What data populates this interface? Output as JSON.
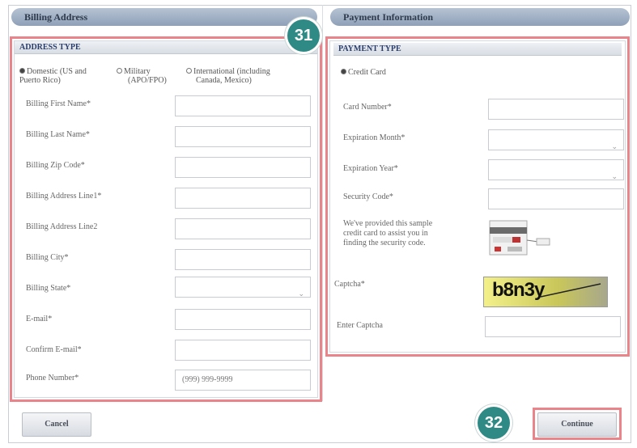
{
  "billing": {
    "header": "Billing Address",
    "address_type_label": "ADDRESS TYPE",
    "address_types": [
      {
        "label_line1": "Domestic (US and",
        "label_line2": "Puerto Rico)",
        "selected": true
      },
      {
        "label_line1": "Military",
        "label_line2": "(APO/FPO)",
        "selected": false
      },
      {
        "label_line1": "International (including",
        "label_line2": "Canada, Mexico)",
        "selected": false
      }
    ],
    "fields": [
      {
        "label": "Billing First Name*",
        "value": ""
      },
      {
        "label": "Billing Last Name*",
        "value": ""
      },
      {
        "label": "Billing Zip Code*",
        "value": ""
      },
      {
        "label": "Billing Address Line1*",
        "value": ""
      },
      {
        "label": "Billing Address Line2",
        "value": ""
      },
      {
        "label": "Billing City*",
        "value": ""
      },
      {
        "label": "Billing State*",
        "value": "",
        "type": "select"
      },
      {
        "label": "E-mail*",
        "value": ""
      },
      {
        "label": "Confirm E-mail*",
        "value": ""
      },
      {
        "label": "Phone Number*",
        "value": "",
        "placeholder": "(999) 999-9999"
      }
    ]
  },
  "payment": {
    "header": "Payment Information",
    "payment_type_label": "PAYMENT TYPE",
    "payment_types": [
      {
        "label": "Credit Card",
        "selected": true
      }
    ],
    "fields": [
      {
        "label": "Card Number*",
        "value": ""
      },
      {
        "label": "Expiration Month*",
        "value": "",
        "type": "select"
      },
      {
        "label": "Expiration Year*",
        "value": "",
        "type": "select"
      },
      {
        "label": "Security Code*",
        "value": ""
      }
    ],
    "security_note_lines": [
      "We've provided this sample",
      "credit card to assist you in",
      "finding the security code."
    ],
    "captcha_label": "Captcha*",
    "captcha_text": "b8n3y",
    "enter_captcha_label": "Enter Captcha",
    "enter_captcha_value": ""
  },
  "callouts": {
    "badge_31": "31",
    "badge_32": "32"
  },
  "buttons": {
    "cancel": "Cancel",
    "continue": "Continue"
  },
  "colors": {
    "header_bg": "#9fb0c6",
    "callout": "#2f8a86",
    "highlight": "#e9858a",
    "subheader_text": "#2a3d6b"
  }
}
